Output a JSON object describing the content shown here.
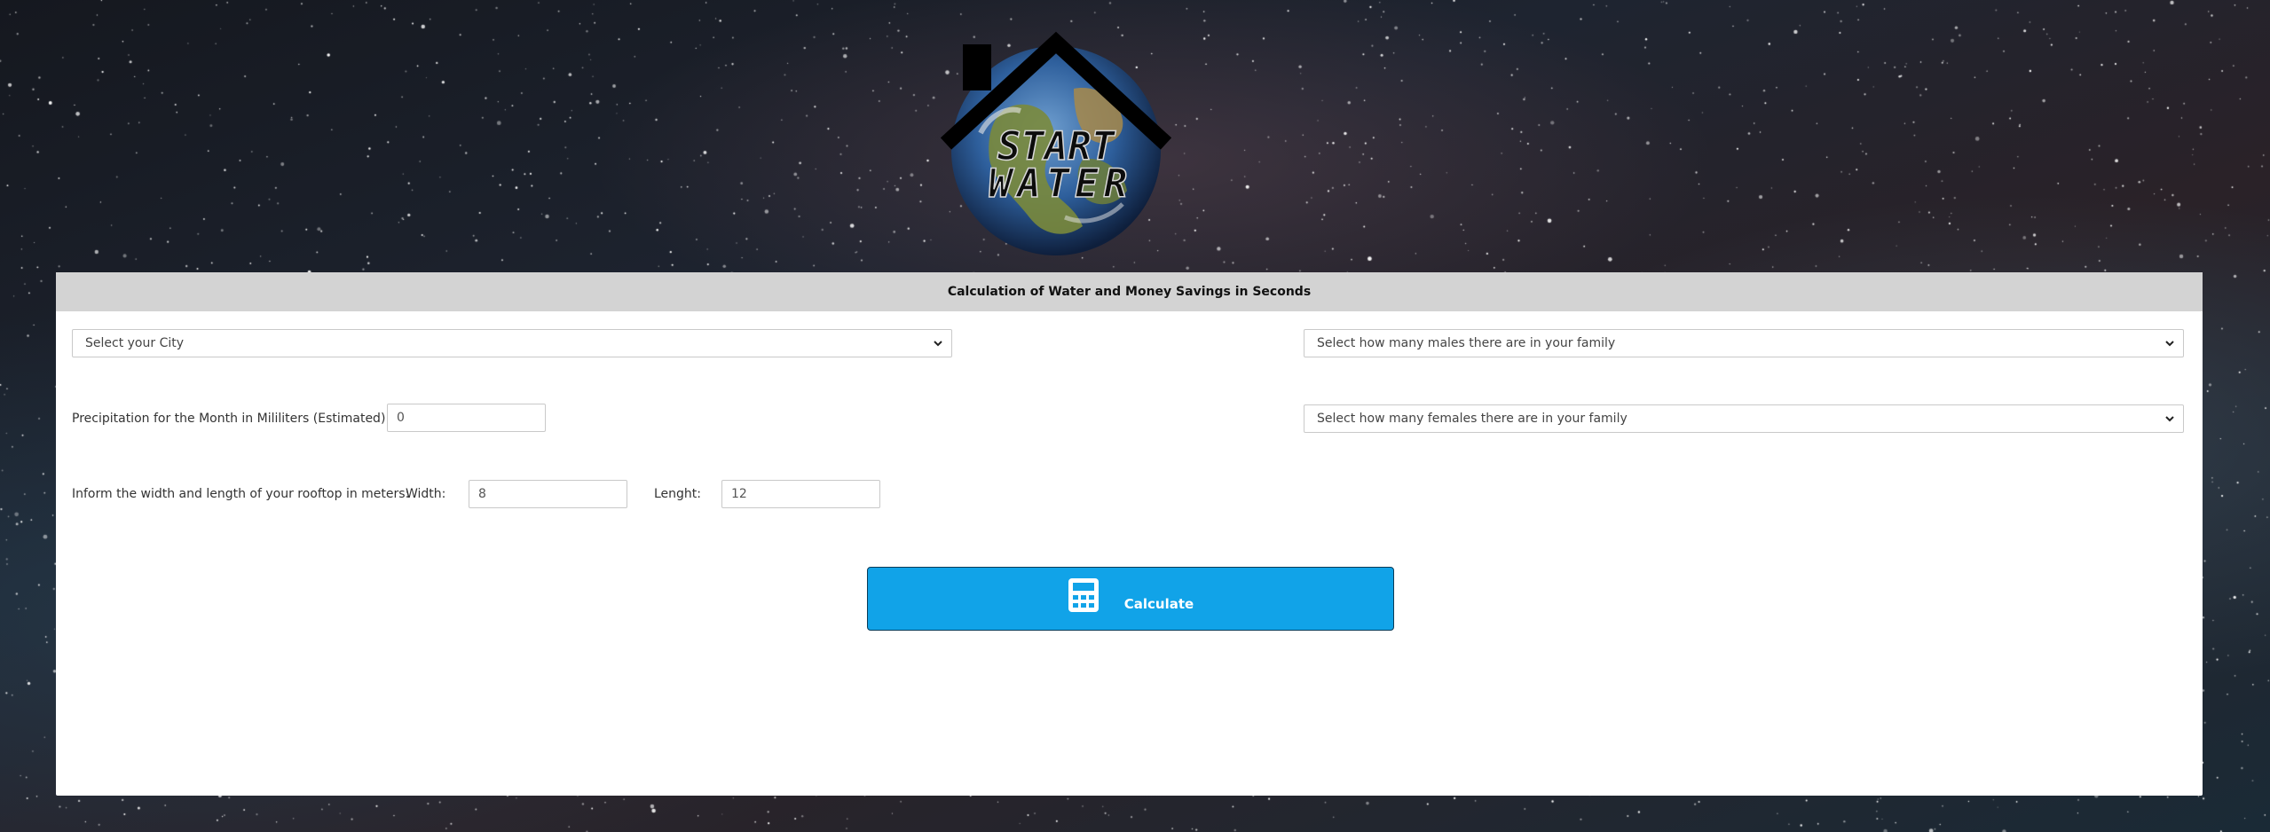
{
  "logo": {
    "line1": "START",
    "line2": "WATER"
  },
  "form": {
    "header": "Calculation of Water and Money Savings in Seconds",
    "city_select": {
      "selected": "Select your City"
    },
    "males_select": {
      "selected": "Select how many males there are in your family"
    },
    "females_select": {
      "selected": "Select how many females there are in your family"
    },
    "precipitation": {
      "label": "Precipitation for the Month in Mililiters (Estimated):",
      "value": "0"
    },
    "rooftop": {
      "label": "Inform the width and length of your rooftop in meters:",
      "width_label": "Width:",
      "width_value": "8",
      "length_label": "Lenght:",
      "length_value": "12"
    },
    "calculate_button": {
      "label": "Calculate",
      "icon": "calculator-icon"
    }
  },
  "colors": {
    "button_bg": "#11a3e8",
    "header_bg": "#d3d3d3",
    "panel_bg": "#ffffff"
  }
}
